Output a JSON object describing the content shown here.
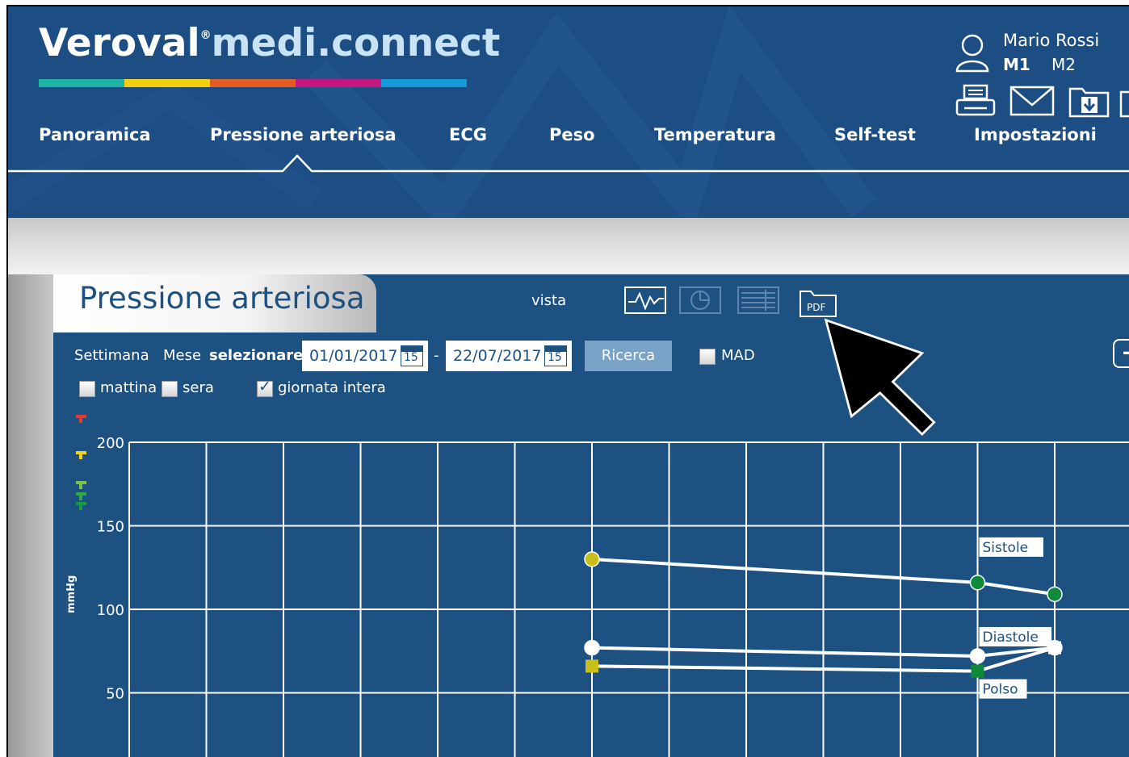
{
  "header": {
    "logo_brand": "Veroval",
    "logo_reg": "®",
    "logo_product": "medi.connect",
    "logo_bar_colors": [
      "#1fb4a6",
      "#f3cf10",
      "#e35d22",
      "#c4177f",
      "#159ad9"
    ],
    "user_name": "Mario Rossi",
    "member_active": "M1",
    "member_other": "M2",
    "tool_icons": [
      "printer-icon",
      "envelope-icon",
      "folder-download-icon",
      "more-icon"
    ]
  },
  "nav": {
    "items": [
      {
        "label": "Panoramica",
        "active": false
      },
      {
        "label": "Pressione arteriosa",
        "active": true
      },
      {
        "label": "ECG",
        "active": false
      },
      {
        "label": "Peso",
        "active": false
      },
      {
        "label": "Temperatura",
        "active": false
      },
      {
        "label": "Self-test",
        "active": false
      },
      {
        "label": "Impostazioni",
        "active": false
      }
    ]
  },
  "panel": {
    "title": "Pressione arteriosa",
    "vista_label": "vista",
    "view_icons": [
      "line-chart-icon",
      "pie-chart-icon",
      "table-list-icon",
      "pdf-folder-icon"
    ],
    "pdf_label": "PDF",
    "filters": {
      "settimana": "Settimana",
      "mese": "Mese",
      "selezionare": "selezionare",
      "date_from": "01/01/2017",
      "date_separator": "-",
      "date_to": "22/07/2017",
      "calendar_day": "15",
      "search_button": "Ricerca",
      "mad_label": "MAD",
      "mad_checked": false,
      "mattina_label": "mattina",
      "mattina_checked": false,
      "sera_label": "sera",
      "sera_checked": false,
      "giornata_label": "giornata intera",
      "giornata_checked": true,
      "check_mark": "✓",
      "add_button": "+"
    }
  },
  "chart_data": {
    "type": "line",
    "ylabel": "mmHg",
    "yticks": [
      200,
      150,
      100,
      50
    ],
    "ylim": [
      0,
      200
    ],
    "xlim": [
      0,
      13
    ],
    "grid": true,
    "x": [
      6,
      11,
      12
    ],
    "series": [
      {
        "name": "Sistole",
        "values": [
          130,
          116,
          109
        ],
        "marker": "circle",
        "point_colors": [
          "#c8bf1a",
          "#0f8a3a",
          "#0f8a3a"
        ]
      },
      {
        "name": "Diastole",
        "values": [
          77,
          72,
          77
        ],
        "marker": "circle",
        "point_colors": [
          "#ffffff",
          "#ffffff",
          "#ffffff"
        ]
      },
      {
        "name": "Polso",
        "values": [
          66,
          63,
          77
        ],
        "marker": "square",
        "point_colors": [
          "#c8bf1a",
          "#0f8a3a",
          "#ffffff"
        ]
      }
    ],
    "legend_placement": "inline-right",
    "threshold_marker_colors": [
      "#e53935",
      "#f0d21a",
      "#7cc14a",
      "#2eaa4a",
      "#1a9a3e"
    ]
  }
}
